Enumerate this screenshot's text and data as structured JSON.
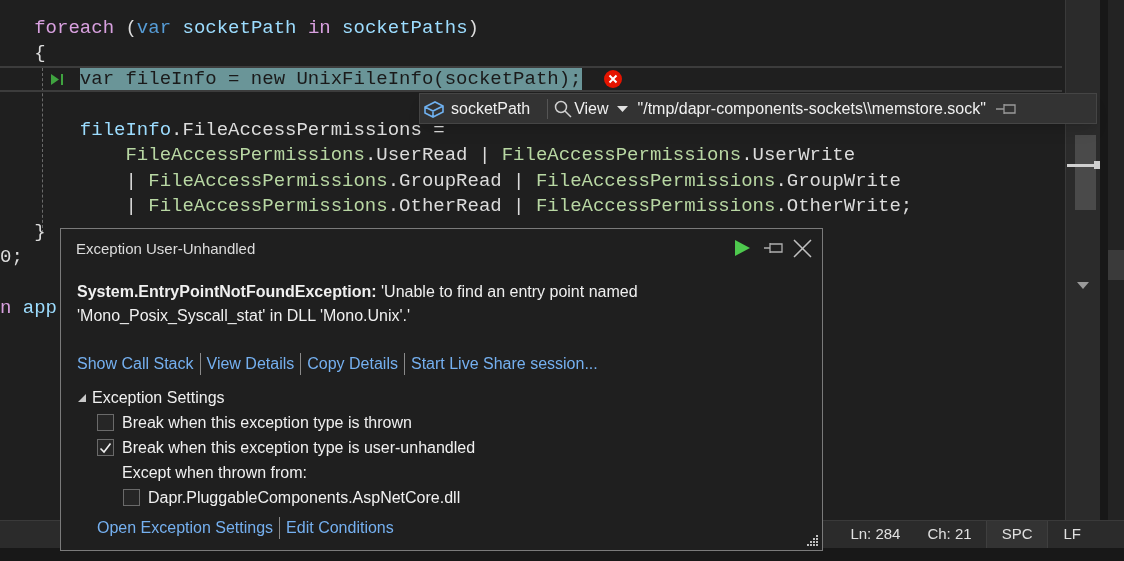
{
  "code": {
    "lines": [
      {
        "current": false,
        "error": false,
        "tokens": [
          {
            "text": "   foreach",
            "kind": "control"
          },
          {
            "text": " (",
            "kind": "plain"
          },
          {
            "text": "var",
            "kind": "keyword"
          },
          {
            "text": " socketPath ",
            "kind": "variable"
          },
          {
            "text": "in",
            "kind": "control"
          },
          {
            "text": " socketPaths",
            "kind": "variable"
          },
          {
            "text": ")",
            "kind": "plain"
          }
        ]
      },
      {
        "current": false,
        "error": false,
        "tokens": [
          {
            "text": "   {",
            "kind": "plain"
          }
        ]
      },
      {
        "current": true,
        "error": true,
        "tokens": [
          {
            "text": "       var fileInfo = new UnixFileInfo(socketPath);",
            "kind": "highlight"
          }
        ]
      },
      {
        "kind": "blank"
      },
      {
        "current": false,
        "error": false,
        "tokens": [
          {
            "text": "       fileInfo",
            "kind": "variable"
          },
          {
            "text": ".FileAccessPermissions =",
            "kind": "plain"
          }
        ]
      },
      {
        "current": false,
        "error": false,
        "tokens": [
          {
            "text": "           FileAccessPermissions",
            "kind": "enum"
          },
          {
            "text": ".UserRead | ",
            "kind": "plain"
          },
          {
            "text": "FileAccessPermissions",
            "kind": "enum"
          },
          {
            "text": ".UserWrite",
            "kind": "plain"
          }
        ]
      },
      {
        "current": false,
        "error": false,
        "tokens": [
          {
            "text": "           | ",
            "kind": "plain"
          },
          {
            "text": "FileAccessPermissions",
            "kind": "enum"
          },
          {
            "text": ".GroupRead | ",
            "kind": "plain"
          },
          {
            "text": "FileAccessPermissions",
            "kind": "enum"
          },
          {
            "text": ".GroupWrite",
            "kind": "plain"
          }
        ]
      },
      {
        "current": false,
        "error": false,
        "tokens": [
          {
            "text": "           | ",
            "kind": "plain"
          },
          {
            "text": "FileAccessPermissions",
            "kind": "enum"
          },
          {
            "text": ".OtherRead | ",
            "kind": "plain"
          },
          {
            "text": "FileAccessPermissions",
            "kind": "enum"
          },
          {
            "text": ".OtherWrite;",
            "kind": "plain"
          }
        ]
      },
      {
        "current": false,
        "error": false,
        "tokens": [
          {
            "text": "   }",
            "kind": "plain"
          }
        ]
      },
      {
        "current": false,
        "error": false,
        "tokens": [
          {
            "text": "0;",
            "kind": "plain"
          }
        ]
      },
      {
        "kind": "blank"
      },
      {
        "current": false,
        "error": false,
        "tokens": [
          {
            "text": "n",
            "kind": "control"
          },
          {
            "text": " app",
            "kind": "variable"
          }
        ]
      }
    ]
  },
  "datatip": {
    "name": "socketPath",
    "view": "View",
    "value": "\"/tmp/dapr-components-sockets\\\\memstore.sock\""
  },
  "exception_popup": {
    "title": "Exception User-Unhandled",
    "message": "**System.EntryPointNotFoundException:** 'Unable to find an entry point named 'Mono_Posix_Syscall_stat' in DLL 'Mono.Unix'.'",
    "links": [
      "Show Call Stack",
      "View Details",
      "Copy Details",
      "Start Live Share session..."
    ],
    "settings": {
      "title": "Exception Settings",
      "expanded": true,
      "options": [
        {
          "kind": "checkbox",
          "label": "Break when this exception type is thrown",
          "checked": false
        },
        {
          "kind": "checkbox",
          "label": "Break when this exception type is user-unhandled",
          "checked": true
        },
        {
          "kind": "label",
          "label": "Except when thrown from:"
        },
        {
          "kind": "subcheckbox",
          "label": "Dapr.PluggableComponents.AspNetCore.dll",
          "checked": false
        }
      ]
    },
    "footer_links": [
      "Open Exception Settings",
      "Edit Conditions"
    ]
  },
  "status_bar": {
    "line": "Ln: 284",
    "column": "Ch: 21",
    "whitespace": "SPC",
    "line_ending": "LF"
  }
}
